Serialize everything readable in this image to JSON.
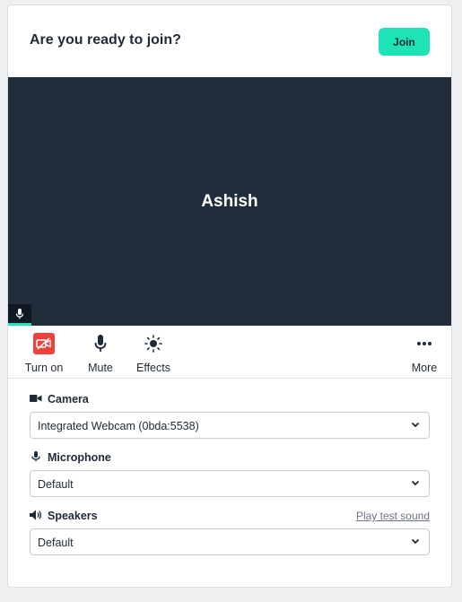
{
  "header": {
    "title": "Are you ready to join?",
    "join_label": "Join"
  },
  "video": {
    "participant_name": "Ashish"
  },
  "toolbar": {
    "camera_label": "Turn on",
    "mute_label": "Mute",
    "effects_label": "Effects",
    "more_label": "More"
  },
  "settings": {
    "camera": {
      "label": "Camera",
      "value": "Integrated Webcam (0bda:5538)"
    },
    "microphone": {
      "label": "Microphone",
      "value": "Default"
    },
    "speakers": {
      "label": "Speakers",
      "value": "Default",
      "test_link": "Play test sound"
    }
  },
  "colors": {
    "accent": "#1ee3b7",
    "video_bg": "#212d3b",
    "camera_off": "#f0403c"
  },
  "icons": [
    "microphone-icon",
    "camera-off-icon",
    "effects-icon",
    "more-icon",
    "camera-icon",
    "speaker-icon",
    "chevron-down-icon"
  ]
}
